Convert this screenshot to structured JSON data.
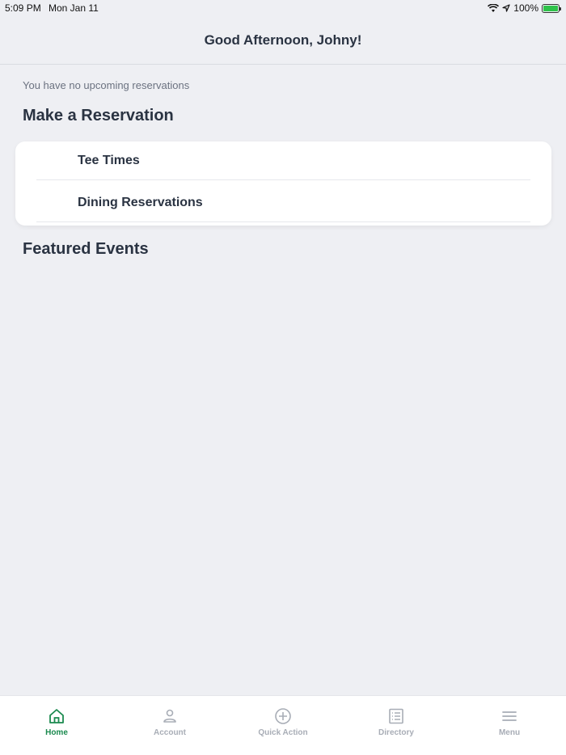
{
  "status_bar": {
    "time": "5:09 PM",
    "date": "Mon Jan 11",
    "battery": "100%"
  },
  "header": {
    "greeting": "Good Afternoon, Johny!"
  },
  "reservations": {
    "empty_message": "You have no upcoming reservations",
    "section_title": "Make a Reservation",
    "items": [
      {
        "label": "Tee Times"
      },
      {
        "label": "Dining Reservations"
      }
    ]
  },
  "events": {
    "section_title": "Featured Events"
  },
  "tabs": [
    {
      "label": "Home",
      "icon": "home-icon",
      "active": true
    },
    {
      "label": "Account",
      "icon": "person-icon",
      "active": false
    },
    {
      "label": "Quick Action",
      "icon": "plus-circle-icon",
      "active": false
    },
    {
      "label": "Directory",
      "icon": "list-icon",
      "active": false
    },
    {
      "label": "Menu",
      "icon": "hamburger-icon",
      "active": false
    }
  ],
  "colors": {
    "accent": "#1b8a4f",
    "inactive": "#a8adb6",
    "background": "#eeeff3",
    "text": "#2a3342"
  }
}
